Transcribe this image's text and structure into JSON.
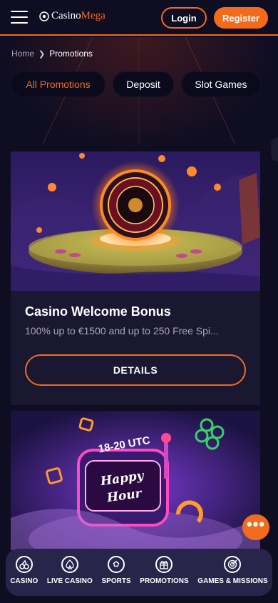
{
  "header": {
    "logo_text_prefix": "Casino",
    "logo_text_suffix": "Mega",
    "login_label": "Login",
    "register_label": "Register"
  },
  "breadcrumb": {
    "home": "Home",
    "current": "Promotions"
  },
  "tabs": [
    {
      "label": "All Promotions",
      "active": true
    },
    {
      "label": "Deposit",
      "active": false
    },
    {
      "label": "Slot Games",
      "active": false
    }
  ],
  "promotions": [
    {
      "title": "Casino Welcome Bonus",
      "description": "100% up to €1500 and up to 250 Free Spi...",
      "button_label": "DETAILS"
    },
    {
      "image_text_top": "18-20 UTC",
      "image_text_main_1": "Happy",
      "image_text_main_2": "Hour"
    }
  ],
  "chat": {
    "icon": "more-dots-icon"
  },
  "bottom_nav": [
    {
      "label": "CASINO",
      "icon": "cherries-icon"
    },
    {
      "label": "LIVE CASINO",
      "icon": "spade-icon"
    },
    {
      "label": "SPORTS",
      "icon": "soccer-ball-icon"
    },
    {
      "label": "PROMOTIONS",
      "icon": "gift-icon"
    },
    {
      "label": "GAMES & MISSIONS",
      "icon": "target-icon"
    }
  ],
  "colors": {
    "accent": "#f26b1d",
    "background": "#0f0d22",
    "card": "#1a1831",
    "nav": "#27254a",
    "muted_text": "#a9a6b8"
  }
}
